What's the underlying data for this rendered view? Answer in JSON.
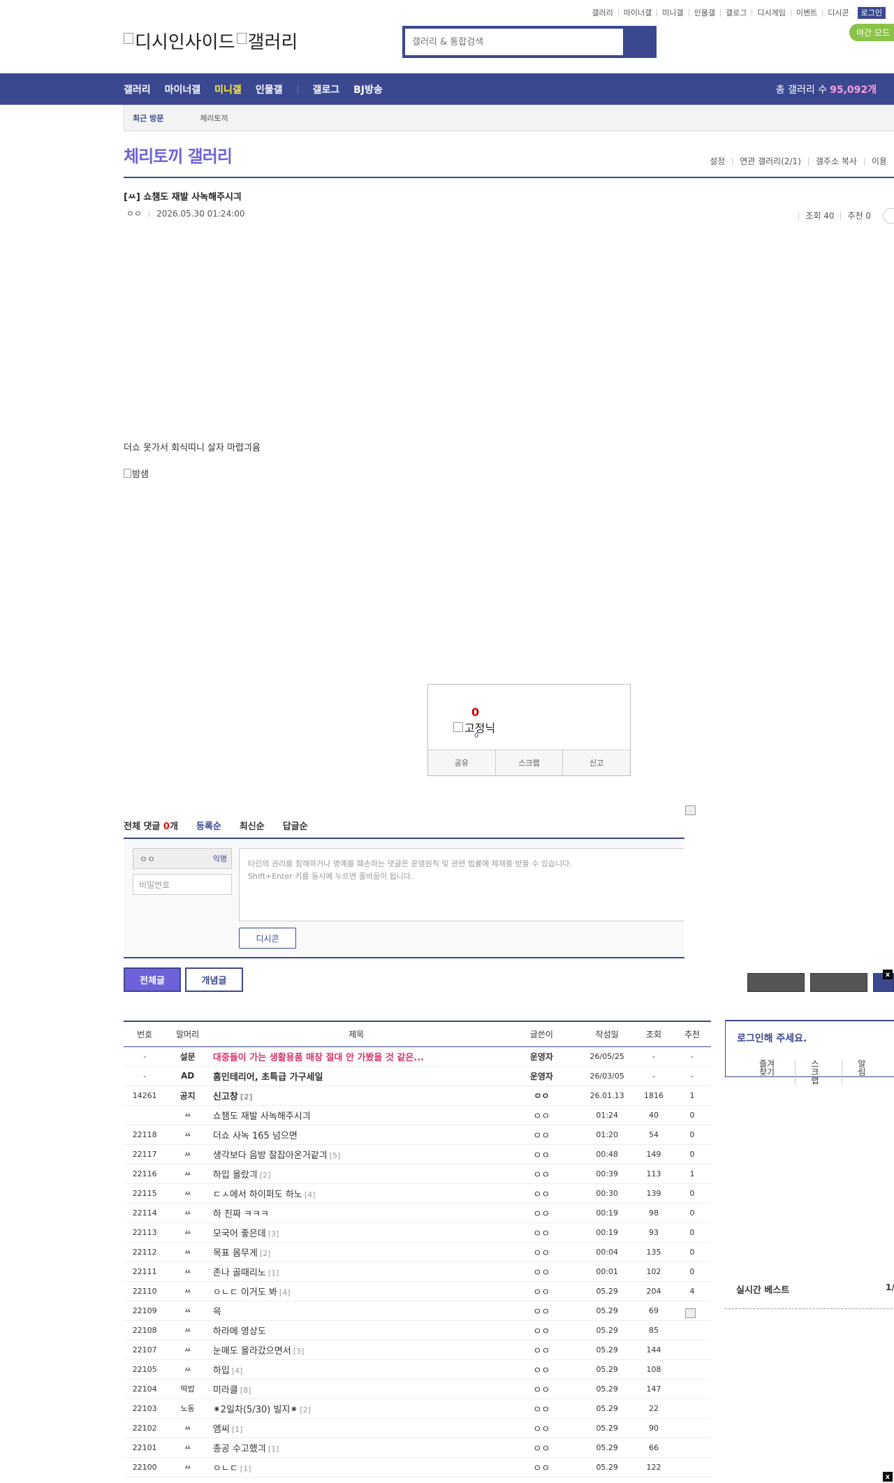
{
  "header": {
    "top_links": [
      "갤러리",
      "마이너갤",
      "미니갤",
      "인물갤",
      "갤로그",
      "디시게임",
      "이벤트",
      "디시콘"
    ],
    "login_label": "로그인",
    "night_mode": "야간 모드",
    "logo_text": "디시인사이드",
    "logo_sub": "갤러리",
    "search_placeholder": "갤러리 & 통합검색"
  },
  "gnb": {
    "items": [
      "갤러리",
      "마이너갤",
      "미니갤",
      "인물갤",
      "갤로그",
      "BJ방송"
    ],
    "active": "미니갤",
    "count_label": "총 갤러리 수",
    "count_value": "95,092개"
  },
  "visit": {
    "label": "최근 방문",
    "item": "체리토끼"
  },
  "gallery": {
    "title": "체리토끼 갤러리",
    "tools": [
      "설정",
      "연관 갤러리(2/1)",
      "갤주소 복사",
      "이용"
    ]
  },
  "post": {
    "title": "[ㅆ] 쇼챔도 재발 사녹해주시긔",
    "author": "ㅇㅇ",
    "date": "2026.05.30 01:24:00",
    "views_label": "조회 40",
    "recommend_label": "추천 0",
    "body": "더쇼 못가서 회식띠니 살자 마렵긔윰",
    "image_alt": "밤샘"
  },
  "recommend": {
    "count": "0",
    "fixed_alt": "고정닉",
    "fixed_count": "0",
    "buttons": [
      "공유",
      "스크랩",
      "신고"
    ]
  },
  "comments": {
    "total_label": "전체 댓글",
    "total_count": "0",
    "total_unit": "개",
    "sort": [
      "등록순",
      "최신순",
      "답글순"
    ],
    "nick": "ㅇㅇ",
    "anon": "익명",
    "password_placeholder": "비밀번호",
    "textarea_line1": "타인의 권리를 침해하거나 명예를 훼손하는 댓글은 운영원칙 및 관련 법률에 제재를 받을 수 있습니다.",
    "textarea_line2": "Shift+Enter 키를 동시에 누르면 줄바꿈이 됩니다.",
    "dccon": "디시콘"
  },
  "list_buttons": {
    "all": "전체글",
    "concept": "개념글"
  },
  "list": {
    "headers": [
      "번호",
      "말머리",
      "제목",
      "글쓴이",
      "작성일",
      "조회",
      "추천"
    ],
    "rows": [
      {
        "no": "-",
        "head": "설문",
        "title": "대중들이 가는 생활용품 매장 절대 안 가봤을 것 같은...",
        "reply": "",
        "writer": "운영자",
        "date": "26/05/25",
        "views": "-",
        "rec": "-",
        "style": "survey"
      },
      {
        "no": "-",
        "head": "AD",
        "title": "홈인테리어, 초특급 가구세일",
        "reply": "",
        "writer": "운영자",
        "date": "26/03/05",
        "views": "-",
        "rec": "-",
        "style": "ad"
      },
      {
        "no": "14261",
        "head": "공지",
        "title": "신고창",
        "reply": "[2]",
        "writer": "ㅇㅇ",
        "date": "26.01.13",
        "views": "1816",
        "rec": "1",
        "style": "notice"
      },
      {
        "no": "",
        "head": "ㅆ",
        "title": "쇼챔도 재발 사녹해주시긔",
        "reply": "",
        "writer": "ㅇㅇ",
        "date": "01:24",
        "views": "40",
        "rec": "0",
        "style": ""
      },
      {
        "no": "22118",
        "head": "ㅆ",
        "title": "더쇼 사녹 165 넘으면",
        "reply": "",
        "writer": "ㅇㅇ",
        "date": "01:20",
        "views": "54",
        "rec": "0",
        "style": ""
      },
      {
        "no": "22117",
        "head": "ㅆ",
        "title": "생각보다 음방 잘잡아온거같긔",
        "reply": "[5]",
        "writer": "ㅇㅇ",
        "date": "00:48",
        "views": "149",
        "rec": "0",
        "style": ""
      },
      {
        "no": "22116",
        "head": "ㅆ",
        "title": "하입 올랐긔",
        "reply": "[2]",
        "writer": "ㅇㅇ",
        "date": "00:39",
        "views": "113",
        "rec": "1",
        "style": ""
      },
      {
        "no": "22115",
        "head": "ㅆ",
        "title": "ㄷㅅ에서 하이퍼도 하노",
        "reply": "[4]",
        "writer": "ㅇㅇ",
        "date": "00:30",
        "views": "139",
        "rec": "0",
        "style": ""
      },
      {
        "no": "22114",
        "head": "ㅆ",
        "title": "하 진짜 ㅋㅋㅋ",
        "reply": "",
        "writer": "ㅇㅇ",
        "date": "00:19",
        "views": "98",
        "rec": "0",
        "style": ""
      },
      {
        "no": "22113",
        "head": "ㅆ",
        "title": "모국어 좋은데",
        "reply": "[3]",
        "writer": "ㅇㅇ",
        "date": "00:19",
        "views": "93",
        "rec": "0",
        "style": ""
      },
      {
        "no": "22112",
        "head": "ㅆ",
        "title": "목표 몸무게",
        "reply": "[2]",
        "writer": "ㅇㅇ",
        "date": "00:04",
        "views": "135",
        "rec": "0",
        "style": ""
      },
      {
        "no": "22111",
        "head": "ㅆ",
        "title": "존나 골때리노",
        "reply": "[1]",
        "writer": "ㅇㅇ",
        "date": "00:01",
        "views": "102",
        "rec": "0",
        "style": ""
      },
      {
        "no": "22110",
        "head": "ㅆ",
        "title": "ㅇㄴㄷ 이거도 봐",
        "reply": "[4]",
        "writer": "ㅇㅇ",
        "date": "05.29",
        "views": "204",
        "rec": "4",
        "style": ""
      },
      {
        "no": "22109",
        "head": "ㅆ",
        "title": "윽",
        "reply": "",
        "writer": "ㅇㅇ",
        "date": "05.29",
        "views": "69",
        "rec": "",
        "style": ""
      },
      {
        "no": "22108",
        "head": "ㅆ",
        "title": "하라메 영상도",
        "reply": "",
        "writer": "ㅇㅇ",
        "date": "05.29",
        "views": "85",
        "rec": "",
        "style": ""
      },
      {
        "no": "22107",
        "head": "ㅆ",
        "title": "눈매도 올라갔으면서",
        "reply": "[3]",
        "writer": "ㅇㅇ",
        "date": "05.29",
        "views": "144",
        "rec": "",
        "style": ""
      },
      {
        "no": "22105",
        "head": "ㅆ",
        "title": "하입",
        "reply": "[4]",
        "writer": "ㅇㅇ",
        "date": "05.29",
        "views": "108",
        "rec": "",
        "style": ""
      },
      {
        "no": "22104",
        "head": "떡밥",
        "title": "미라클",
        "reply": "[8]",
        "writer": "ㅇㅇ",
        "date": "05.29",
        "views": "147",
        "rec": "",
        "style": ""
      },
      {
        "no": "22103",
        "head": "노동",
        "title": "⁕2일차(5/30) 빌지⁕",
        "reply": "[2]",
        "writer": "ㅇㅇ",
        "date": "05.29",
        "views": "22",
        "rec": "",
        "style": ""
      },
      {
        "no": "22102",
        "head": "ㅆ",
        "title": "엠씨",
        "reply": "[1]",
        "writer": "ㅇㅇ",
        "date": "05.29",
        "views": "90",
        "rec": "",
        "style": ""
      },
      {
        "no": "22101",
        "head": "ㅆ",
        "title": "총공 수고했긔",
        "reply": "[1]",
        "writer": "ㅇㅇ",
        "date": "05.29",
        "views": "66",
        "rec": "",
        "style": ""
      },
      {
        "no": "22100",
        "head": "ㅆ",
        "title": "ㅇㄴㄷ",
        "reply": "[1]",
        "writer": "ㅇㅇ",
        "date": "05.29",
        "views": "122",
        "rec": "",
        "style": ""
      }
    ]
  },
  "sidebar": {
    "login_title": "로그인해 주세요.",
    "login_links": [
      "즐겨찾기",
      "스크랩",
      "알림"
    ],
    "best_title": "실시간 베스트",
    "best_page": "1/"
  },
  "close_label": "x"
}
